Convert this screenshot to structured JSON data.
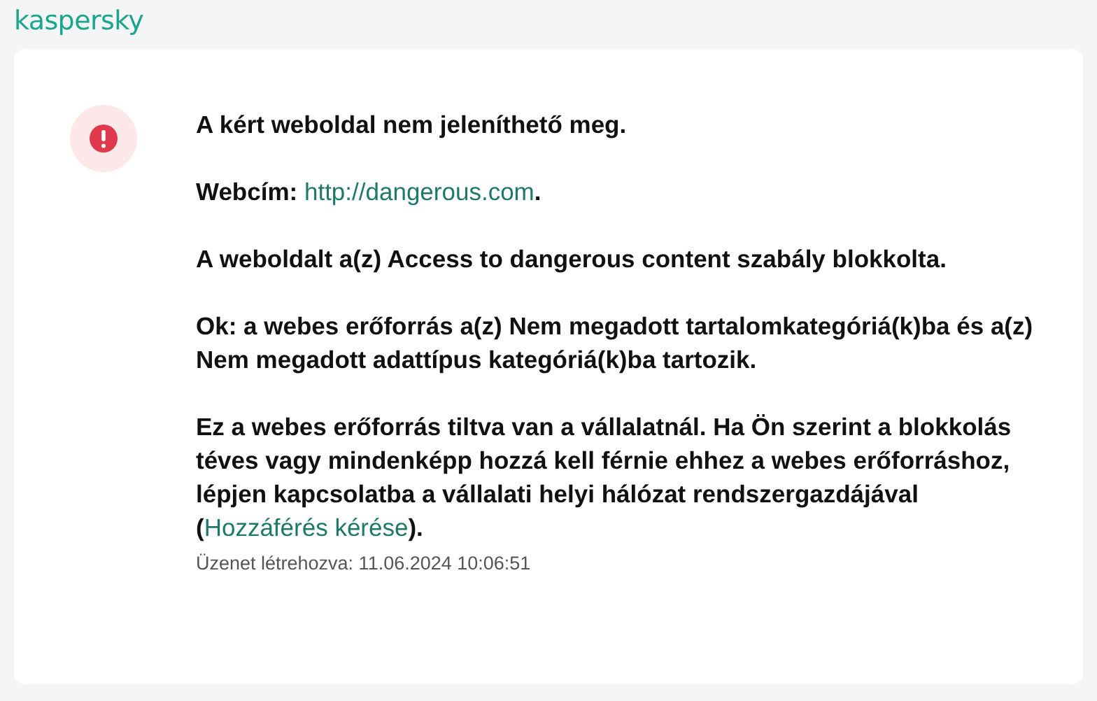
{
  "logo": "kaspersky",
  "title": "A kért weboldal nem jeleníthető meg.",
  "paragraphs": [
    {
      "before": "Webcím: ",
      "link": "http://dangerous.com",
      "after": "."
    },
    {
      "before": "A weboldalt a(z) Access to dangerous content szabály blokkolta."
    },
    {
      "before": "Ok: a webes erőforrás a(z) Nem megadott tartalomkategóriá(k)ba és a(z) Nem megadott adattípus kategóriá(k)ba tartozik."
    },
    {
      "before": "Ez a webes erőforrás tiltva van a vállalatnál. Ha Ön szerint a blokkolás téves vagy mindenképp hozzá kell férnie ehhez a webes erőforráshoz, lépjen kapcsolatba a vállalati helyi hálózat rendszergazdájával (",
      "link": "Hozzáférés kérése",
      "after": ")."
    }
  ],
  "timestamp": "Üzenet létrehozva: 11.06.2024 10:06:51"
}
